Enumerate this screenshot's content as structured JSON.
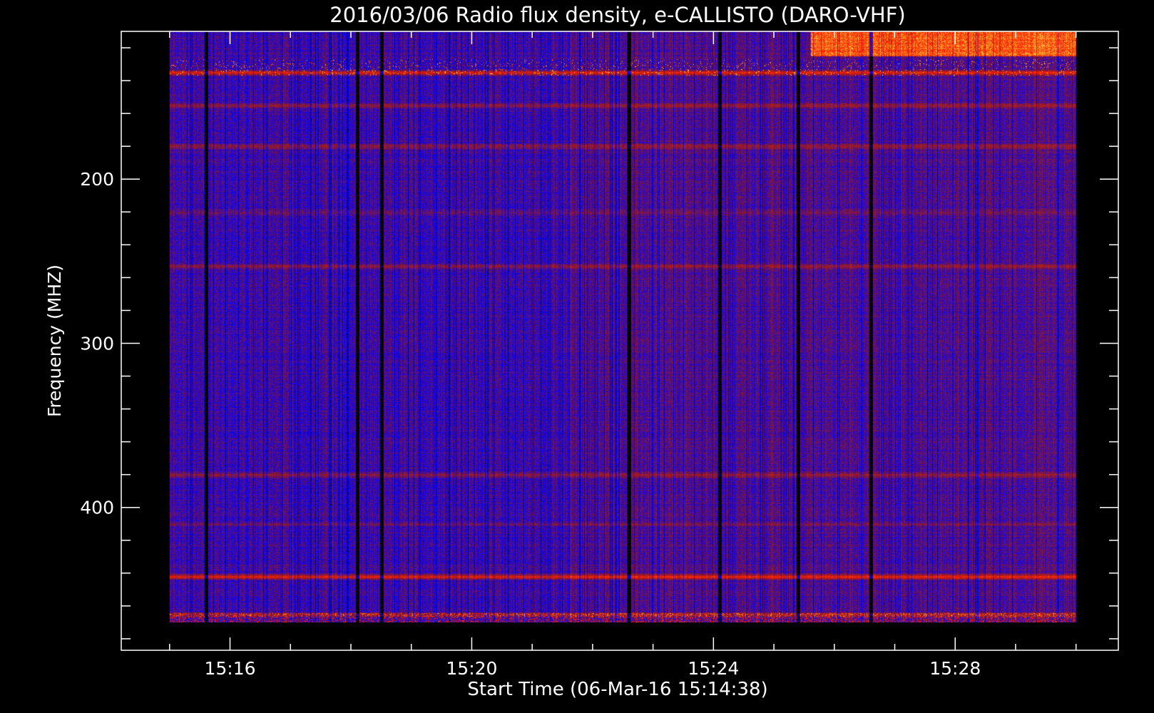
{
  "chart_data": {
    "type": "heatmap",
    "title": "2016/03/06  Radio flux density, e-CALLISTO (DARO-VHF)",
    "xlabel": "Start Time (06-Mar-16 15:14:38)",
    "ylabel": "Frequency (MHZ)",
    "x_tick_labels": [
      "15:16",
      "15:20",
      "15:24",
      "15:28"
    ],
    "x_tick_minutes": [
      16,
      20,
      24,
      28
    ],
    "y_tick_labels": [
      "200",
      "300",
      "400"
    ],
    "y_tick_values": [
      200,
      300,
      400
    ],
    "x_range_minutes": [
      14.2,
      30.7
    ],
    "data_range_minutes": [
      15.0,
      30.0
    ],
    "y_range_mhz": [
      110,
      487
    ],
    "data_range_mhz": [
      110,
      470
    ],
    "colormap": [
      "#000000",
      "#0000ff",
      "#8a1a30",
      "#ff2000",
      "#ffee44"
    ],
    "grid": false,
    "features": {
      "horizontal_bands_mhz": [
        {
          "f": 135,
          "level": "high"
        },
        {
          "f": 155,
          "level": "mid"
        },
        {
          "f": 180,
          "level": "mid"
        },
        {
          "f": 220,
          "level": "low"
        },
        {
          "f": 253,
          "level": "mid"
        },
        {
          "f": 380,
          "level": "mid"
        },
        {
          "f": 410,
          "level": "low"
        },
        {
          "f": 442,
          "level": "high"
        },
        {
          "f": 465,
          "level": "mid"
        }
      ],
      "bright_region": {
        "minutes": [
          25.6,
          30.0
        ],
        "mhz": [
          110,
          125
        ]
      },
      "dark_columns_minutes": [
        15.6,
        18.1,
        18.5,
        22.6,
        24.1,
        25.4,
        26.6
      ]
    }
  }
}
